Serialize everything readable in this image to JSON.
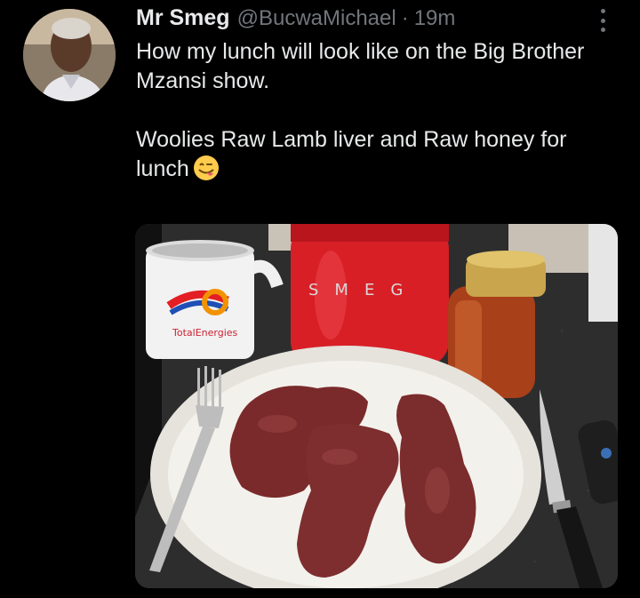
{
  "tweet": {
    "author_name": "Mr Smeg",
    "handle": "@BucwaMichael",
    "separator": "·",
    "time": "19m",
    "text_line1": "How my lunch will look like on the Big Brother Mzansi show.",
    "text_line2": "Woolies Raw Lamb liver and Raw honey for lunch",
    "emoji": "savoring-food-emoji"
  },
  "photo": {
    "mug_brand": "TotalEnergies",
    "kettle_brand": "SMEG"
  },
  "icons": {
    "more": "more-dots-icon"
  },
  "colors": {
    "background": "#000000",
    "text": "#e7e9ea",
    "secondary": "#71767b"
  }
}
